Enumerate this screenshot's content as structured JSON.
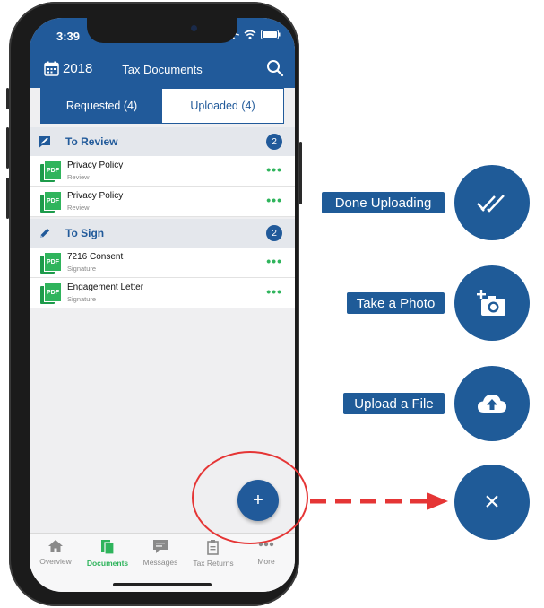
{
  "status_bar": {
    "time": "3:39"
  },
  "header": {
    "year": "2018",
    "title": "Tax Documents"
  },
  "segments": {
    "requested": "Requested (4)",
    "uploaded": "Uploaded (4)"
  },
  "sections": [
    {
      "label": "To Review",
      "count": "2",
      "items": [
        {
          "name": "Privacy Policy",
          "sub": "Review"
        },
        {
          "name": "Privacy Policy",
          "sub": "Review"
        }
      ]
    },
    {
      "label": "To Sign",
      "count": "2",
      "items": [
        {
          "name": "7216 Consent",
          "sub": "Signature"
        },
        {
          "name": "Engagement Letter",
          "sub": "Signature"
        }
      ]
    }
  ],
  "pdf_label": "PDF",
  "more_dots": "•••",
  "fab_symbol": "+",
  "tabs": [
    {
      "label": "Overview",
      "icon": "home-icon"
    },
    {
      "label": "Documents",
      "icon": "documents-icon",
      "active": true
    },
    {
      "label": "Messages",
      "icon": "message-icon"
    },
    {
      "label": "Tax Returns",
      "icon": "tax-returns-icon"
    },
    {
      "label": "More",
      "icon": "more-icon"
    }
  ],
  "actions": {
    "done_uploading": "Done Uploading",
    "take_photo": "Take a Photo",
    "upload_file": "Upload a File",
    "close_symbol": "×"
  },
  "colors": {
    "brand_blue": "#215a9a",
    "accent_green": "#2fb45c",
    "highlight_red": "#e53535"
  }
}
